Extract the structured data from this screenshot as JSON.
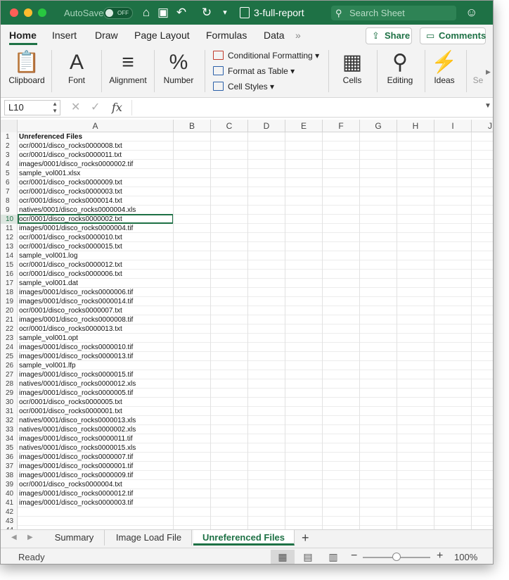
{
  "titlebar": {
    "autosave_label": "AutoSave",
    "toggle_state": "OFF",
    "document_title": "3-full-report",
    "search_placeholder": "Search Sheet"
  },
  "tabs": [
    {
      "label": "Home",
      "active": true
    },
    {
      "label": "Insert"
    },
    {
      "label": "Draw"
    },
    {
      "label": "Page Layout"
    },
    {
      "label": "Formulas"
    },
    {
      "label": "Data"
    }
  ],
  "tabs_overflow": "»",
  "share_label": "Share",
  "comments_label": "Comments",
  "ribbon": {
    "clipboard": "Clipboard",
    "font": "Font",
    "alignment": "Alignment",
    "number": "Number",
    "conditional_formatting": "Conditional Formatting",
    "format_as_table": "Format as Table",
    "cell_styles": "Cell Styles",
    "cells": "Cells",
    "editing": "Editing",
    "ideas": "Ideas",
    "sensitivity_partial": "Se"
  },
  "formula_bar": {
    "name_box": "L10",
    "cancel": "✕",
    "enter": "✓",
    "fx": "fx",
    "formula": ""
  },
  "columns": [
    "A",
    "B",
    "C",
    "D",
    "E",
    "F",
    "G",
    "H",
    "I",
    "J"
  ],
  "rows": [
    {
      "n": "1",
      "a": "Unreferenced Files"
    },
    {
      "n": "2",
      "a": "ocr/0001/disco_rocks0000008.txt"
    },
    {
      "n": "3",
      "a": "ocr/0001/disco_rocks0000011.txt"
    },
    {
      "n": "4",
      "a": "images/0001/disco_rocks0000002.tif"
    },
    {
      "n": "5",
      "a": "sample_vol001.xlsx"
    },
    {
      "n": "6",
      "a": "ocr/0001/disco_rocks0000009.txt"
    },
    {
      "n": "7",
      "a": "ocr/0001/disco_rocks0000003.txt"
    },
    {
      "n": "8",
      "a": "ocr/0001/disco_rocks0000014.txt"
    },
    {
      "n": "9",
      "a": "natives/0001/disco_rocks0000004.xls"
    },
    {
      "n": "10",
      "a": "ocr/0001/disco_rocks0000002.txt"
    },
    {
      "n": "11",
      "a": "images/0001/disco_rocks0000004.tif"
    },
    {
      "n": "12",
      "a": "ocr/0001/disco_rocks0000010.txt"
    },
    {
      "n": "13",
      "a": "ocr/0001/disco_rocks0000015.txt"
    },
    {
      "n": "14",
      "a": "sample_vol001.log"
    },
    {
      "n": "15",
      "a": "ocr/0001/disco_rocks0000012.txt"
    },
    {
      "n": "16",
      "a": "ocr/0001/disco_rocks0000006.txt"
    },
    {
      "n": "17",
      "a": "sample_vol001.dat"
    },
    {
      "n": "18",
      "a": "images/0001/disco_rocks0000006.tif"
    },
    {
      "n": "19",
      "a": "images/0001/disco_rocks0000014.tif"
    },
    {
      "n": "20",
      "a": "ocr/0001/disco_rocks0000007.txt"
    },
    {
      "n": "21",
      "a": "images/0001/disco_rocks0000008.tif"
    },
    {
      "n": "22",
      "a": "ocr/0001/disco_rocks0000013.txt"
    },
    {
      "n": "23",
      "a": "sample_vol001.opt"
    },
    {
      "n": "24",
      "a": "images/0001/disco_rocks0000010.tif"
    },
    {
      "n": "25",
      "a": "images/0001/disco_rocks0000013.tif"
    },
    {
      "n": "26",
      "a": "sample_vol001.lfp"
    },
    {
      "n": "27",
      "a": "images/0001/disco_rocks0000015.tif"
    },
    {
      "n": "28",
      "a": "natives/0001/disco_rocks0000012.xls"
    },
    {
      "n": "29",
      "a": "images/0001/disco_rocks0000005.tif"
    },
    {
      "n": "30",
      "a": "ocr/0001/disco_rocks0000005.txt"
    },
    {
      "n": "31",
      "a": "ocr/0001/disco_rocks0000001.txt"
    },
    {
      "n": "32",
      "a": "natives/0001/disco_rocks0000013.xls"
    },
    {
      "n": "33",
      "a": "natives/0001/disco_rocks0000002.xls"
    },
    {
      "n": "34",
      "a": "images/0001/disco_rocks0000011.tif"
    },
    {
      "n": "35",
      "a": "natives/0001/disco_rocks0000015.xls"
    },
    {
      "n": "36",
      "a": "images/0001/disco_rocks0000007.tif"
    },
    {
      "n": "37",
      "a": "images/0001/disco_rocks0000001.tif"
    },
    {
      "n": "38",
      "a": "images/0001/disco_rocks0000009.tif"
    },
    {
      "n": "39",
      "a": "ocr/0001/disco_rocks0000004.txt"
    },
    {
      "n": "40",
      "a": "images/0001/disco_rocks0000012.tif"
    },
    {
      "n": "41",
      "a": "images/0001/disco_rocks0000003.tif"
    },
    {
      "n": "42",
      "a": ""
    },
    {
      "n": "43",
      "a": ""
    },
    {
      "n": "44",
      "a": ""
    }
  ],
  "selected_row": "10",
  "sheets": [
    "Summary",
    "Image Load File",
    "Unreferenced Files"
  ],
  "active_sheet": "Unreferenced Files",
  "add_sheet": "+",
  "status": {
    "ready": "Ready",
    "zoom": "100%",
    "zoom_minus": "−",
    "zoom_plus": "+"
  },
  "colors": {
    "brand_green": "#1e7145"
  }
}
